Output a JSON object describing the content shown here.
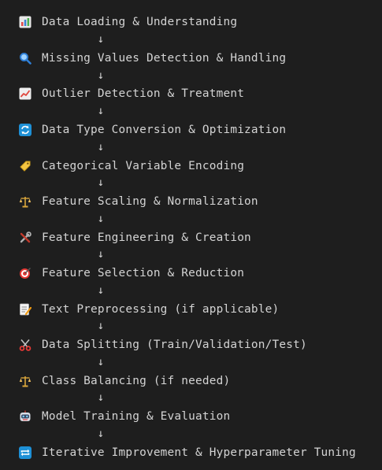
{
  "arrow_glyph": "↓",
  "steps": [
    {
      "label": "Data Loading & Understanding",
      "icon": "bar-chart-icon"
    },
    {
      "label": "Missing Values Detection & Handling",
      "icon": "magnifier-icon"
    },
    {
      "label": "Outlier Detection & Treatment",
      "icon": "trend-chart-icon"
    },
    {
      "label": "Data Type Conversion & Optimization",
      "icon": "refresh-icon"
    },
    {
      "label": "Categorical Variable Encoding",
      "icon": "tag-icon"
    },
    {
      "label": "Feature Scaling & Normalization",
      "icon": "balance-scale-icon"
    },
    {
      "label": "Feature Engineering & Creation",
      "icon": "tools-icon"
    },
    {
      "label": "Feature Selection & Reduction",
      "icon": "target-icon"
    },
    {
      "label": "Text Preprocessing (if applicable)",
      "icon": "memo-icon"
    },
    {
      "label": "Data Splitting (Train/Validation/Test)",
      "icon": "scissors-icon"
    },
    {
      "label": "Class Balancing (if needed)",
      "icon": "balance-scale-icon"
    },
    {
      "label": "Model Training & Evaluation",
      "icon": "robot-icon"
    },
    {
      "label": "Iterative Improvement & Hyperparameter Tuning",
      "icon": "repeat-icon"
    }
  ]
}
